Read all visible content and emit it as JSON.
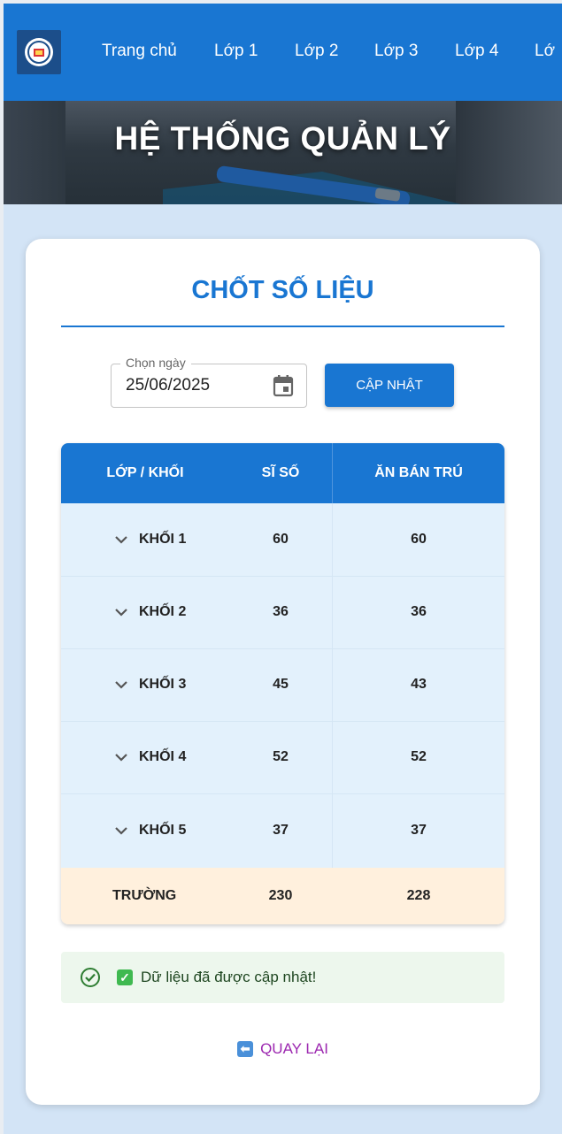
{
  "navbar": {
    "logo_icon": "school-emblem-icon",
    "items": [
      "Trang chủ",
      "Lớp 1",
      "Lớp 2",
      "Lớp 3",
      "Lớp 4",
      "Lớ"
    ]
  },
  "hero": {
    "title": "HỆ THỐNG QUẢN LÝ"
  },
  "card": {
    "title": "CHỐT SỐ LIỆU",
    "date_label": "Chọn ngày",
    "date_value": "25/06/2025",
    "date_icon": "calendar-icon",
    "update_button": "CẬP NHẬT"
  },
  "table": {
    "headers": [
      "LỚP / KHỐI",
      "SĨ SỐ",
      "ĂN BÁN TRÚ"
    ],
    "rows": [
      {
        "name": "KHỐI 1",
        "si_so": "60",
        "ban_tru": "60"
      },
      {
        "name": "KHỐI 2",
        "si_so": "36",
        "ban_tru": "36"
      },
      {
        "name": "KHỐI 3",
        "si_so": "45",
        "ban_tru": "43"
      },
      {
        "name": "KHỐI 4",
        "si_so": "52",
        "ban_tru": "52"
      },
      {
        "name": "KHỐI 5",
        "si_so": "37",
        "ban_tru": "37"
      }
    ],
    "total": {
      "name": "TRƯỜNG",
      "si_so": "230",
      "ban_tru": "228"
    }
  },
  "alert": {
    "text": "Dữ liệu đã được cập nhật!",
    "icon": "check-circle-icon"
  },
  "back": {
    "label": "QUAY LẠI",
    "icon": "back-arrow-icon"
  },
  "colors": {
    "primary": "#1976d2",
    "success_bg": "#edf7ed",
    "total_bg": "#fff0dd",
    "link": "#9c27b0"
  }
}
